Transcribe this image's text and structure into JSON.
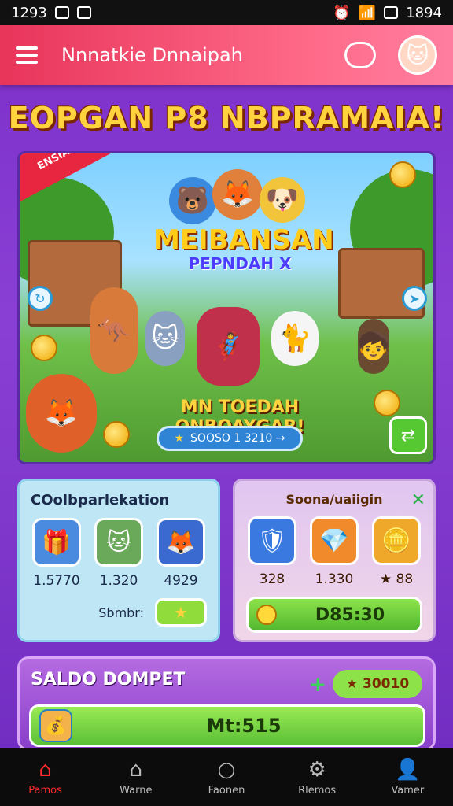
{
  "status_bar": {
    "time": "1293",
    "right_time": "1894"
  },
  "app_bar": {
    "title": "Nnnatkie Dnnaipah"
  },
  "headline": "EOPGAN P8 NBPRAMAIA!",
  "banner": {
    "ribbon_text": "ENSIAK DASAS",
    "logo_main": "MEIBANSAN",
    "logo_sub": "PEPNDAH X",
    "caption": "MN TOEDAH ONBOAYGAR!",
    "score_pill": "SOOSO 1 3210 →"
  },
  "card_left": {
    "title": "COolbparlekation",
    "items": [
      {
        "icon": "gift-box-icon",
        "value": "1.5770"
      },
      {
        "icon": "cat-icon",
        "value": "1.320"
      },
      {
        "icon": "fox-icon",
        "value": "4929"
      }
    ],
    "send_label": "Sbmbr:"
  },
  "card_right": {
    "title": "Soona/uaiigin",
    "items": [
      {
        "icon": "shield-icon",
        "value": "328"
      },
      {
        "icon": "gem-icon",
        "value": "1.330"
      },
      {
        "icon": "gold-coin-icon",
        "value": "★ 88"
      }
    ],
    "button_value": "D85:30"
  },
  "wallet": {
    "title": "SALDO DOMPET",
    "chip_value": "★ 30010",
    "bar_value": "Mt:515"
  },
  "bottom_nav": [
    {
      "label": "Pamos",
      "icon": "home-icon"
    },
    {
      "label": "Warne",
      "icon": "house-icon"
    },
    {
      "label": "Faonen",
      "icon": "circle-icon"
    },
    {
      "label": "Rlemos",
      "icon": "gear-icon"
    },
    {
      "label": "Vamer",
      "icon": "user-icon"
    }
  ],
  "colors": {
    "accent": "#e8355a",
    "background": "#7b2fc9",
    "gold": "#ffd33d",
    "green": "#56c832"
  }
}
